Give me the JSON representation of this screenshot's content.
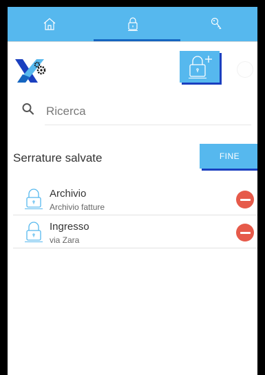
{
  "tabs": [
    {
      "icon": "home-icon",
      "active": false
    },
    {
      "icon": "lock-icon",
      "active": true
    },
    {
      "icon": "key-icon",
      "active": false
    }
  ],
  "colors": {
    "accent": "#56b8ee",
    "accent_shadow": "#1a3fbf",
    "tab_indicator": "#1565c0",
    "delete": "#e65a4a"
  },
  "header": {
    "logo_icon": "app-logo-x-gear",
    "add_lock_icon": "add-lock-icon"
  },
  "search": {
    "placeholder": "Ricerca",
    "value": ""
  },
  "saved_locks": {
    "title": "Serrature salvate",
    "done_label": "FINE",
    "items": [
      {
        "name": "Archivio",
        "subtitle": "Archivio fatture"
      },
      {
        "name": "Ingresso",
        "subtitle": "via Zara"
      }
    ]
  }
}
